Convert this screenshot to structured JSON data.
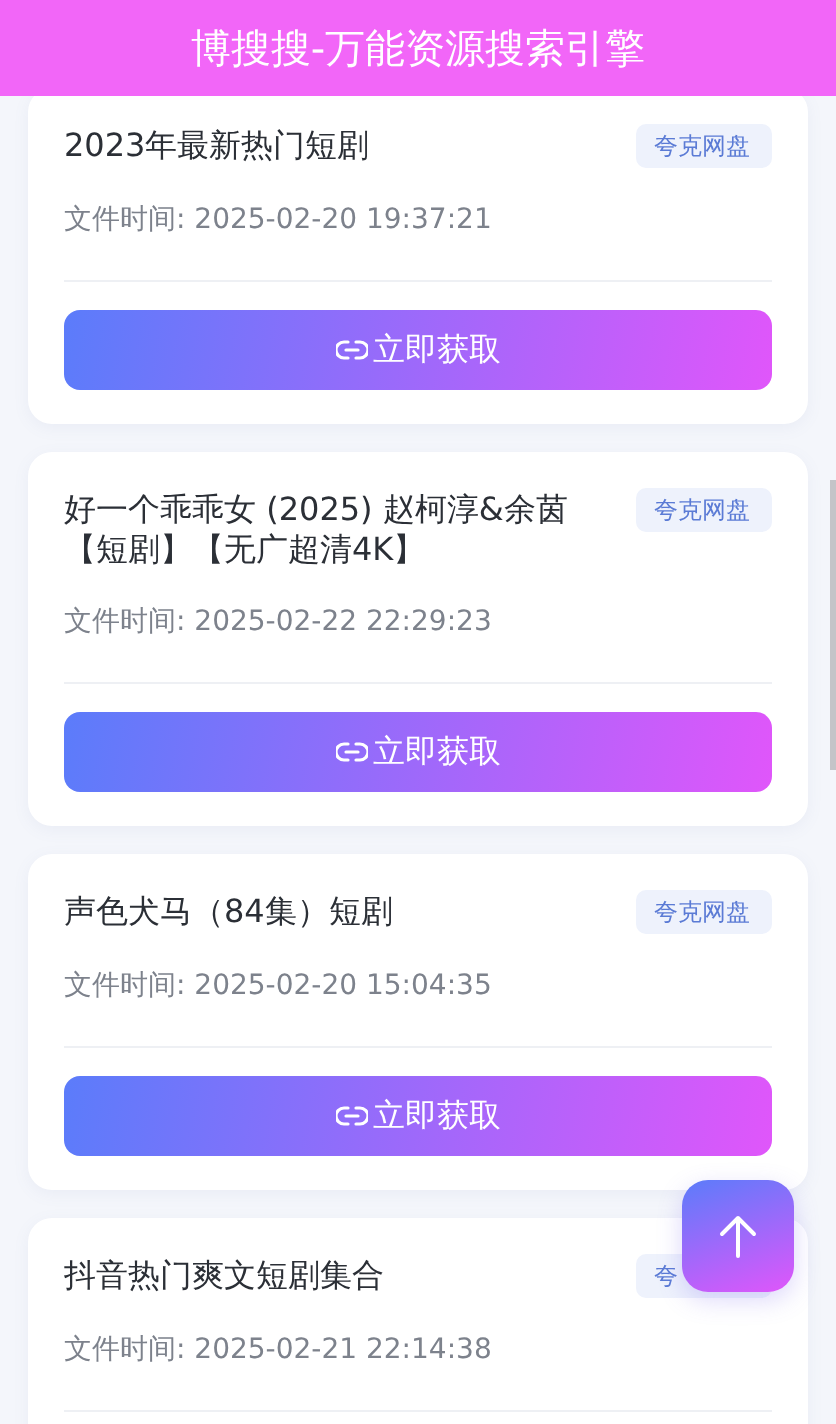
{
  "header": {
    "title": "博搜搜-万能资源搜索引擎"
  },
  "results": [
    {
      "title": "2023年最新热门短剧",
      "tag": "夸克网盘",
      "time": "文件时间: 2025-02-20 19:37:21",
      "button": "立即获取"
    },
    {
      "title": "好一个乖乖女 (2025) 赵柯淳&余茵【短剧】【无广超清4K】",
      "tag": "夸克网盘",
      "time": "文件时间: 2025-02-22 22:29:23",
      "button": "立即获取"
    },
    {
      "title": "声色犬马（84集）短剧",
      "tag": "夸克网盘",
      "time": "文件时间: 2025-02-20 15:04:35",
      "button": "立即获取"
    },
    {
      "title": "抖音热门爽文短剧集合",
      "tag": "夸",
      "time": "文件时间: 2025-02-21 22:14:38"
    }
  ]
}
